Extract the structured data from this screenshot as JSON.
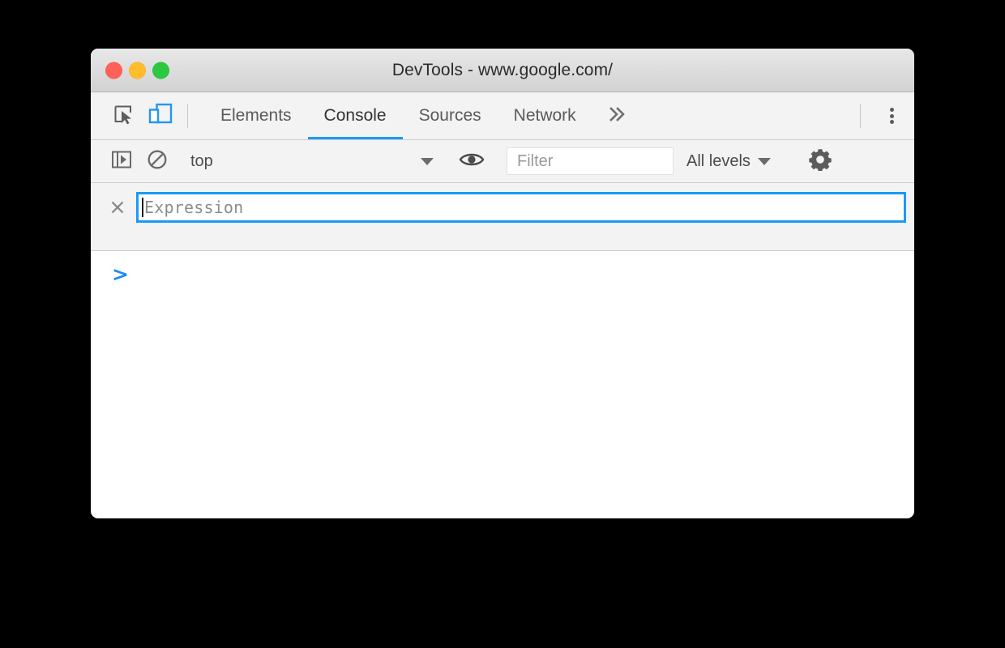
{
  "window": {
    "title": "DevTools - www.google.com/",
    "controls": [
      {
        "name": "close",
        "color": "#ff6057"
      },
      {
        "name": "minimize",
        "color": "#ffbd2e"
      },
      {
        "name": "zoom",
        "color": "#2bc840"
      }
    ]
  },
  "toolbar": {
    "inspect_icon": "inspect-element-cursor-icon",
    "device_icon": "toggle-device-toolbar-icon",
    "more_tabs_label": "»",
    "kebab_icon": "more-options-kebab-icon"
  },
  "tabs": [
    {
      "label": "Elements",
      "active": false
    },
    {
      "label": "Console",
      "active": true
    },
    {
      "label": "Sources",
      "active": false
    },
    {
      "label": "Network",
      "active": false
    }
  ],
  "console_toolbar": {
    "sidebar_icon": "console-sidebar-toggle-icon",
    "clear_icon": "clear-console-icon",
    "context": {
      "value": "top",
      "options": [
        "top"
      ]
    },
    "eye_icon": "create-live-expression-eye-icon",
    "filter": {
      "value": "",
      "placeholder": "Filter"
    },
    "levels": {
      "value": "All levels",
      "options": [
        "All levels"
      ]
    },
    "settings_icon": "settings-gear-icon"
  },
  "live_expression": {
    "close_label": "×",
    "value": "",
    "placeholder": "Expression"
  },
  "console_output": {
    "prompt": ">"
  },
  "colors": {
    "accent": "#1a9af5",
    "prompt": "#1a8cf0",
    "toolbar_bg": "#f3f3f3",
    "titlebar_bg": "#dcdcdc",
    "border": "#cdcdcd",
    "text": "#4c4c4c",
    "placeholder": "#8c8c8c"
  }
}
